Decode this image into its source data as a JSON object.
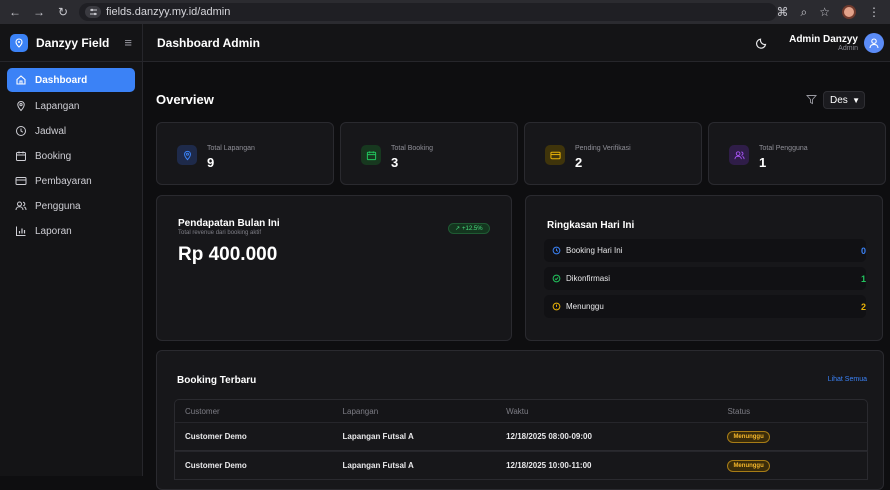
{
  "browser": {
    "url": "fields.danzyy.my.id/admin"
  },
  "sidebar": {
    "brand": "Danzyy Field",
    "items": [
      {
        "label": "Dashboard",
        "icon": "home-icon"
      },
      {
        "label": "Lapangan",
        "icon": "map-pin-icon"
      },
      {
        "label": "Jadwal",
        "icon": "clock-icon"
      },
      {
        "label": "Booking",
        "icon": "calendar-icon"
      },
      {
        "label": "Pembayaran",
        "icon": "credit-card-icon"
      },
      {
        "label": "Pengguna",
        "icon": "users-icon"
      },
      {
        "label": "Laporan",
        "icon": "bar-chart-icon"
      }
    ]
  },
  "topbar": {
    "title": "Dashboard Admin",
    "user_name": "Admin Danzyy",
    "user_role": "Admin"
  },
  "overview": {
    "title": "Overview",
    "month": "Des"
  },
  "stats": [
    {
      "label": "Total Lapangan",
      "value": "9",
      "color": "#3b82f6"
    },
    {
      "label": "Total Booking",
      "value": "3",
      "color": "#22c55e"
    },
    {
      "label": "Pending Verifikasi",
      "value": "2",
      "color": "#eab308"
    },
    {
      "label": "Total Pengguna",
      "value": "1",
      "color": "#a855f7"
    }
  ],
  "revenue": {
    "title": "Pendapatan Bulan Ini",
    "subtitle": "Total revenue dari booking aktif",
    "badge": "+12.5%",
    "value": "Rp 400.000"
  },
  "summary": {
    "title": "Ringkasan Hari Ini",
    "rows": [
      {
        "label": "Booking Hari Ini",
        "value": "0",
        "color": "#3b82f6"
      },
      {
        "label": "Dikonfirmasi",
        "value": "1",
        "color": "#22c55e"
      },
      {
        "label": "Menunggu",
        "value": "2",
        "color": "#eab308"
      }
    ]
  },
  "bookings": {
    "title": "Booking Terbaru",
    "see_all": "Lihat Semua",
    "columns": [
      "Customer",
      "Lapangan",
      "Waktu",
      "Status"
    ],
    "rows": [
      {
        "customer": "Customer Demo",
        "field": "Lapangan Futsal A",
        "time": "12/18/2025 08:00-09:00",
        "status": "Menunggu"
      },
      {
        "customer": "Customer Demo",
        "field": "Lapangan Futsal A",
        "time": "12/18/2025 10:00-11:00",
        "status": "Menunggu"
      }
    ]
  }
}
